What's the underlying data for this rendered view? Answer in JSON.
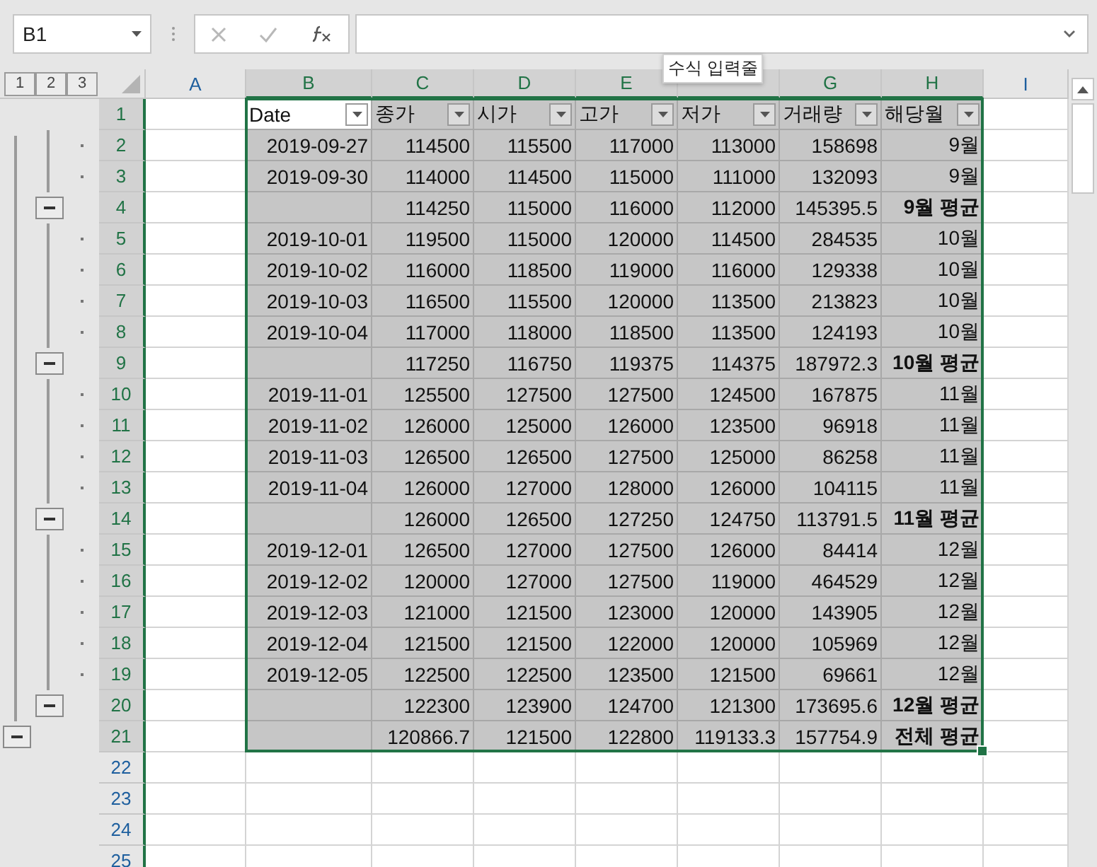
{
  "name_box": {
    "value": "B1"
  },
  "formula_bar": {
    "tooltip": "수식 입력줄"
  },
  "outline_levels": [
    "1",
    "2",
    "3"
  ],
  "columns": [
    {
      "letter": "A",
      "selected": false
    },
    {
      "letter": "B",
      "selected": true
    },
    {
      "letter": "C",
      "selected": true
    },
    {
      "letter": "D",
      "selected": true
    },
    {
      "letter": "E",
      "selected": true
    },
    {
      "selected": true
    },
    {
      "letter": "G",
      "selected": true
    },
    {
      "letter": "H",
      "selected": true
    },
    {
      "letter": "I",
      "selected": false
    }
  ],
  "header_row": {
    "number": "1",
    "selected": true,
    "fields": [
      {
        "label": "Date",
        "active": true
      },
      {
        "label": "종가",
        "active": false
      },
      {
        "label": "시가",
        "active": false
      },
      {
        "label": "고가",
        "active": false
      },
      {
        "label": "저가",
        "active": false
      },
      {
        "label": "거래량",
        "active": false
      },
      {
        "label": "해당월",
        "active": false
      }
    ]
  },
  "rows": [
    {
      "number": "2",
      "kind": "detail",
      "selected": true,
      "date": "2019-09-27",
      "values": [
        "114500",
        "115500",
        "117000",
        "113000",
        "158698"
      ],
      "month": "9월"
    },
    {
      "number": "3",
      "kind": "detail",
      "selected": true,
      "date": "2019-09-30",
      "values": [
        "114000",
        "114500",
        "115000",
        "111000",
        "132093"
      ],
      "month": "9월"
    },
    {
      "number": "4",
      "kind": "subtotal",
      "selected": true,
      "values": [
        "114250",
        "115000",
        "116000",
        "112000",
        "145395.5"
      ],
      "month": "9월 평균"
    },
    {
      "number": "5",
      "kind": "detail",
      "selected": true,
      "date": "2019-10-01",
      "values": [
        "119500",
        "115000",
        "120000",
        "114500",
        "284535"
      ],
      "month": "10월"
    },
    {
      "number": "6",
      "kind": "detail",
      "selected": true,
      "date": "2019-10-02",
      "values": [
        "116000",
        "118500",
        "119000",
        "116000",
        "129338"
      ],
      "month": "10월"
    },
    {
      "number": "7",
      "kind": "detail",
      "selected": true,
      "date": "2019-10-03",
      "values": [
        "116500",
        "115500",
        "120000",
        "113500",
        "213823"
      ],
      "month": "10월"
    },
    {
      "number": "8",
      "kind": "detail",
      "selected": true,
      "date": "2019-10-04",
      "values": [
        "117000",
        "118000",
        "118500",
        "113500",
        "124193"
      ],
      "month": "10월"
    },
    {
      "number": "9",
      "kind": "subtotal",
      "selected": true,
      "values": [
        "117250",
        "116750",
        "119375",
        "114375",
        "187972.3"
      ],
      "month": "10월 평균"
    },
    {
      "number": "10",
      "kind": "detail",
      "selected": true,
      "date": "2019-11-01",
      "values": [
        "125500",
        "127500",
        "127500",
        "124500",
        "167875"
      ],
      "month": "11월"
    },
    {
      "number": "11",
      "kind": "detail",
      "selected": true,
      "date": "2019-11-02",
      "values": [
        "126000",
        "125000",
        "126000",
        "123500",
        "96918"
      ],
      "month": "11월"
    },
    {
      "number": "12",
      "kind": "detail",
      "selected": true,
      "date": "2019-11-03",
      "values": [
        "126500",
        "126500",
        "127500",
        "125000",
        "86258"
      ],
      "month": "11월"
    },
    {
      "number": "13",
      "kind": "detail",
      "selected": true,
      "date": "2019-11-04",
      "values": [
        "126000",
        "127000",
        "128000",
        "126000",
        "104115"
      ],
      "month": "11월"
    },
    {
      "number": "14",
      "kind": "subtotal",
      "selected": true,
      "values": [
        "126000",
        "126500",
        "127250",
        "124750",
        "113791.5"
      ],
      "month": "11월 평균"
    },
    {
      "number": "15",
      "kind": "detail",
      "selected": true,
      "date": "2019-12-01",
      "values": [
        "126500",
        "127000",
        "127500",
        "126000",
        "84414"
      ],
      "month": "12월"
    },
    {
      "number": "16",
      "kind": "detail",
      "selected": true,
      "date": "2019-12-02",
      "values": [
        "120000",
        "127000",
        "127500",
        "119000",
        "464529"
      ],
      "month": "12월"
    },
    {
      "number": "17",
      "kind": "detail",
      "selected": true,
      "date": "2019-12-03",
      "values": [
        "121000",
        "121500",
        "123000",
        "120000",
        "143905"
      ],
      "month": "12월"
    },
    {
      "number": "18",
      "kind": "detail",
      "selected": true,
      "date": "2019-12-04",
      "values": [
        "121500",
        "121500",
        "122000",
        "120000",
        "105969"
      ],
      "month": "12월"
    },
    {
      "number": "19",
      "kind": "detail",
      "selected": true,
      "date": "2019-12-05",
      "values": [
        "122500",
        "122500",
        "123500",
        "121500",
        "69661"
      ],
      "month": "12월"
    },
    {
      "number": "20",
      "kind": "subtotal",
      "selected": true,
      "values": [
        "122300",
        "123900",
        "124700",
        "121300",
        "173695.6"
      ],
      "month": "12월 평균"
    },
    {
      "number": "21",
      "kind": "total",
      "selected": true,
      "values": [
        "120866.7",
        "121500",
        "122800",
        "119133.3",
        "157754.9"
      ],
      "month": "전체 평균"
    },
    {
      "number": "22",
      "kind": "empty",
      "selected": false
    },
    {
      "number": "23",
      "kind": "empty",
      "selected": false
    },
    {
      "number": "24",
      "kind": "empty",
      "selected": false
    },
    {
      "number": "25",
      "kind": "empty",
      "selected": false
    }
  ]
}
